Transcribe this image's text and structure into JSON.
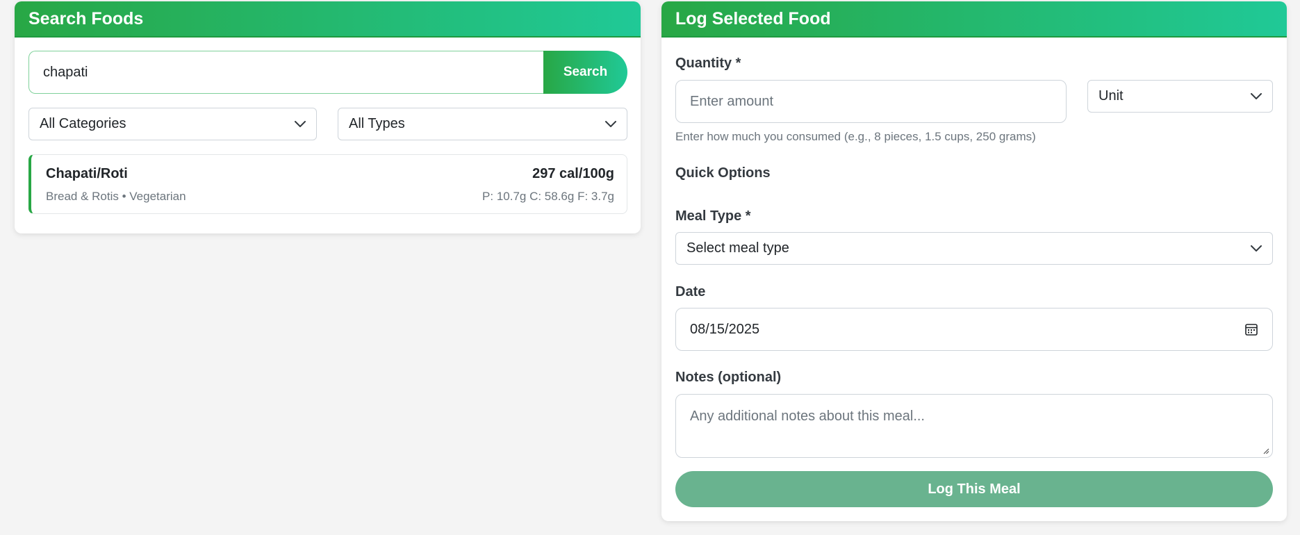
{
  "search_card": {
    "title": "Search Foods",
    "search_value": "chapati",
    "search_button": "Search",
    "category_select": "All Categories",
    "type_select": "All Types",
    "results": [
      {
        "name": "Chapati/Roti",
        "calories": "297 cal/100g",
        "meta": "Bread & Rotis • Vegetarian",
        "macros": "P: 10.7g C: 58.6g F: 3.7g"
      }
    ]
  },
  "log_card": {
    "title": "Log Selected Food",
    "quantity_label": "Quantity *",
    "quantity_placeholder": "Enter amount",
    "unit_select": "Unit",
    "quantity_help": "Enter how much you consumed (e.g., 8 pieces, 1.5 cups, 250 grams)",
    "quick_options_label": "Quick Options",
    "meal_type_label": "Meal Type *",
    "meal_type_select": "Select meal type",
    "date_label": "Date",
    "date_value": "08/15/2025",
    "notes_label": "Notes (optional)",
    "notes_placeholder": "Any additional notes about this meal...",
    "log_button": "Log This Meal"
  },
  "icons": {
    "dropdown": "chevron-down-icon",
    "date": "calendar-icon"
  },
  "colors": {
    "accent_start": "#28a745",
    "accent_end": "#20c997",
    "disabled_button": "#69b38f"
  }
}
